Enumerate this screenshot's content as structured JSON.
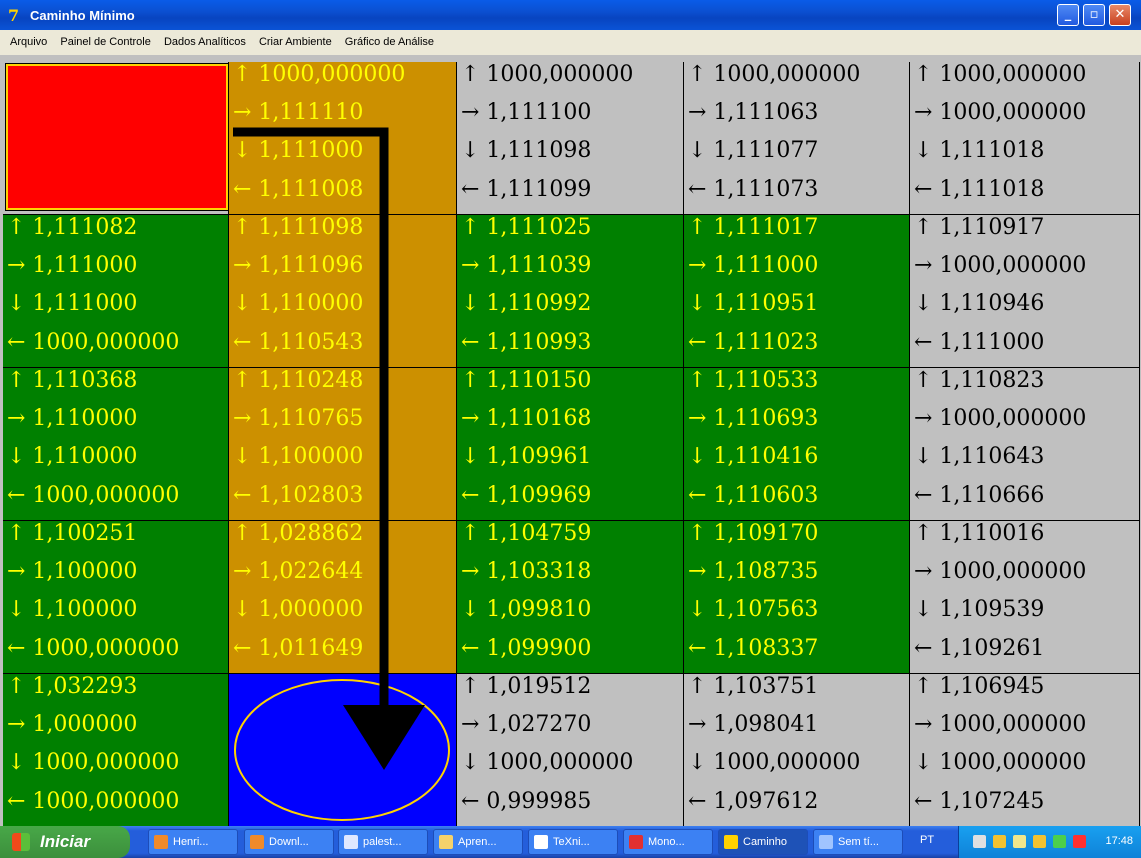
{
  "window": {
    "title": "Caminho Mínimo",
    "buttons": {
      "minimize": "_",
      "maximize": "▫",
      "close": "✕"
    }
  },
  "menu": [
    "Arquivo",
    "Painel de Controle",
    "Dados Analíticos",
    "Criar Ambiente",
    "Gráfico de Análise"
  ],
  "colors": {
    "green": "#008000",
    "gold": "#cc9000",
    "gray": "#c0c0c0",
    "yellow_text": "#ffff00",
    "red": "#ff0000",
    "blue": "#0000ff",
    "path": "#000000"
  },
  "grid": {
    "rows": [
      [
        {
          "type": "start",
          "color": "gray"
        },
        {
          "color": "gold",
          "values": [
            "↑ 1000,000000",
            "→ 1,111110",
            "↓ 1,111000",
            "← 1,111008"
          ]
        },
        {
          "color": "gray",
          "values": [
            "↑ 1000,000000",
            "→ 1,111100",
            "↓ 1,111098",
            "← 1,111099"
          ]
        },
        {
          "color": "gray",
          "values": [
            "↑ 1000,000000",
            "→ 1,111063",
            "↓ 1,111077",
            "← 1,111073"
          ]
        },
        {
          "color": "gray",
          "values": [
            "↑ 1000,000000",
            "→ 1000,000000",
            "↓ 1,111018",
            "← 1,111018"
          ]
        }
      ],
      [
        {
          "color": "green",
          "values": [
            "↑ 1,111082",
            "→ 1,111000",
            "↓ 1,111000",
            "← 1000,000000"
          ]
        },
        {
          "color": "gold",
          "values": [
            "↑ 1,111098",
            "→ 1,111096",
            "↓ 1,110000",
            "← 1,110543"
          ]
        },
        {
          "color": "green",
          "values": [
            "↑ 1,111025",
            "→ 1,111039",
            "↓ 1,110992",
            "← 1,110993"
          ]
        },
        {
          "color": "green",
          "values": [
            "↑ 1,111017",
            "→ 1,111000",
            "↓ 1,110951",
            "← 1,111023"
          ]
        },
        {
          "color": "gray",
          "values": [
            "↑ 1,110917",
            "→ 1000,000000",
            "↓ 1,110946",
            "← 1,111000"
          ]
        }
      ],
      [
        {
          "color": "green",
          "values": [
            "↑ 1,110368",
            "→ 1,110000",
            "↓ 1,110000",
            "← 1000,000000"
          ]
        },
        {
          "color": "gold",
          "values": [
            "↑ 1,110248",
            "→ 1,110765",
            "↓ 1,100000",
            "← 1,102803"
          ]
        },
        {
          "color": "green",
          "values": [
            "↑ 1,110150",
            "→ 1,110168",
            "↓ 1,109961",
            "← 1,109969"
          ]
        },
        {
          "color": "green",
          "values": [
            "↑ 1,110533",
            "→ 1,110693",
            "↓ 1,110416",
            "← 1,110603"
          ]
        },
        {
          "color": "gray",
          "values": [
            "↑ 1,110823",
            "→ 1000,000000",
            "↓ 1,110643",
            "← 1,110666"
          ]
        }
      ],
      [
        {
          "color": "green",
          "values": [
            "↑ 1,100251",
            "→ 1,100000",
            "↓ 1,100000",
            "← 1000,000000"
          ]
        },
        {
          "color": "gold",
          "values": [
            "↑ 1,028862",
            "→ 1,022644",
            "↓ 1,000000",
            "← 1,011649"
          ]
        },
        {
          "color": "green",
          "values": [
            "↑ 1,104759",
            "→ 1,103318",
            "↓ 1,099810",
            "← 1,099900"
          ]
        },
        {
          "color": "green",
          "values": [
            "↑ 1,109170",
            "→ 1,108735",
            "↓ 1,107563",
            "← 1,108337"
          ]
        },
        {
          "color": "gray",
          "values": [
            "↑ 1,110016",
            "→ 1000,000000",
            "↓ 1,109539",
            "← 1,109261"
          ]
        }
      ],
      [
        {
          "color": "green",
          "values": [
            "↑ 1,032293",
            "→ 1,000000",
            "↓ 1000,000000",
            "← 1000,000000"
          ]
        },
        {
          "type": "goal",
          "color": "blue"
        },
        {
          "color": "gray",
          "values": [
            "↑ 1,019512",
            "→ 1,027270",
            "↓ 1000,000000",
            "← 0,999985"
          ]
        },
        {
          "color": "gray",
          "values": [
            "↑ 1,103751",
            "→ 1,098041",
            "↓ 1000,000000",
            "← 1,097612"
          ]
        },
        {
          "color": "gray",
          "values": [
            "↑ 1,106945",
            "→ 1000,000000",
            "↓ 1000,000000",
            "← 1,107245"
          ]
        }
      ]
    ]
  },
  "taskbar": {
    "start_label": "Iniciar",
    "tasks": [
      {
        "label": "Henri...",
        "icon": "firefox-icon"
      },
      {
        "label": "Downl...",
        "icon": "firefox-icon"
      },
      {
        "label": "palest...",
        "icon": "word-icon"
      },
      {
        "label": "Apren...",
        "icon": "folder-icon"
      },
      {
        "label": "TeXni...",
        "icon": "texnic-icon"
      },
      {
        "label": "Mono...",
        "icon": "pdf-icon"
      },
      {
        "label": "Caminho",
        "icon": "app-icon",
        "active": true
      },
      {
        "label": "Sem tí...",
        "icon": "paint-icon"
      }
    ],
    "language": "PT",
    "clock": "17:48"
  }
}
